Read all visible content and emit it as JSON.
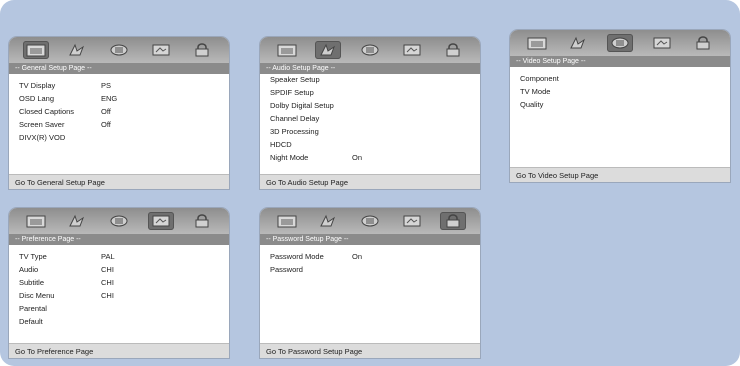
{
  "icons": [
    "general-setup-icon",
    "audio-setup-icon",
    "video-setup-icon",
    "preference-icon",
    "password-lock-icon"
  ],
  "panels": [
    {
      "title": "-- General Setup Page --",
      "active_tab": 0,
      "items": [
        {
          "label": "TV Display",
          "value": "PS"
        },
        {
          "label": "OSD Lang",
          "value": "ENG"
        },
        {
          "label": "Closed Captions",
          "value": "Off"
        },
        {
          "label": "Screen Saver",
          "value": "Off"
        },
        {
          "label": "DIVX(R) VOD",
          "value": ""
        }
      ],
      "footer": "Go To General Setup Page"
    },
    {
      "title": "-- Audio Setup Page --",
      "active_tab": 1,
      "items": [
        {
          "label": "Speaker Setup",
          "value": ""
        },
        {
          "label": "SPDIF Setup",
          "value": ""
        },
        {
          "label": "Dolby Digital Setup",
          "value": ""
        },
        {
          "label": "Channel Delay",
          "value": ""
        },
        {
          "label": "3D Processing",
          "value": ""
        },
        {
          "label": "HDCD",
          "value": ""
        },
        {
          "label": "Night Mode",
          "value": "On"
        }
      ],
      "footer": "Go To Audio Setup Page"
    },
    {
      "title": "-- Video Setup Page --",
      "active_tab": 2,
      "items": [
        {
          "label": "Component",
          "value": ""
        },
        {
          "label": "TV Mode",
          "value": ""
        },
        {
          "label": "Quality",
          "value": ""
        }
      ],
      "footer": "Go To Video Setup Page"
    },
    {
      "title": "-- Preference Page --",
      "active_tab": 3,
      "items": [
        {
          "label": "TV Type",
          "value": "PAL"
        },
        {
          "label": "Audio",
          "value": "CHI"
        },
        {
          "label": "Subtitle",
          "value": "CHI"
        },
        {
          "label": "Disc Menu",
          "value": "CHI"
        },
        {
          "label": "Parental",
          "value": ""
        },
        {
          "label": "Default",
          "value": ""
        }
      ],
      "footer": "Go To Preference Page"
    },
    {
      "title": "-- Password Setup Page --",
      "active_tab": 4,
      "items": [
        {
          "label": "Password Mode",
          "value": "On"
        },
        {
          "label": "Password",
          "value": ""
        }
      ],
      "footer": "Go To Password Setup Page"
    }
  ]
}
